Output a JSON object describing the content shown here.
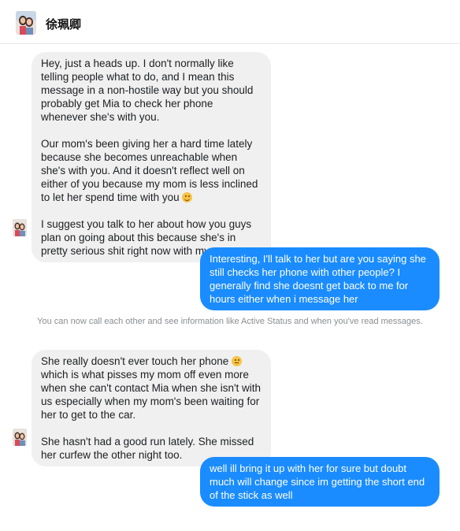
{
  "header": {
    "contact_name": "徐珮卿"
  },
  "messages": [
    {
      "direction": "incoming",
      "paragraphs": [
        "Hey, just a heads up. I don't normally like telling people what to do, and I mean this message in a non-hostile way but you should probably get Mia to check her phone whenever she's with you.",
        "Our mom's been giving her a hard time lately because she becomes unreachable when she's with you. And it doesn't reflect well on either of you because my mom is less inclined to let her spend time with you",
        "I suggest you talk to her about how you guys plan on going about this because she's in pretty serious shit right now with my mom."
      ],
      "emoji_after_paragraph_2": "grinning-face"
    },
    {
      "direction": "outgoing",
      "text": "Interesting, I'll talk to her but are you saying she still checks her phone with other people? I generally find she doesnt get back to me for hours either when i message her"
    },
    {
      "direction": "incoming",
      "paragraphs": [
        "She really doesn't ever touch her phone",
        "which is what pisses my mom off even more when she can't contact Mia when she isn't with us especially when my mom's been waiting for her to get to the car.",
        "She hasn't had a good run lately. She missed her curfew the other night too."
      ],
      "emoji_inline": "eye-roll-face"
    },
    {
      "direction": "outgoing",
      "text": "well ill bring it up with her for sure but doubt much will change since im getting the short end of the stick as well"
    }
  ],
  "system_note": "You can now call each other and see information like Active Status and when you've read messages.",
  "colors": {
    "outgoing_bubble": "#1a8cff",
    "incoming_bubble": "#f0f0f0",
    "system_text": "#8a8d91"
  }
}
